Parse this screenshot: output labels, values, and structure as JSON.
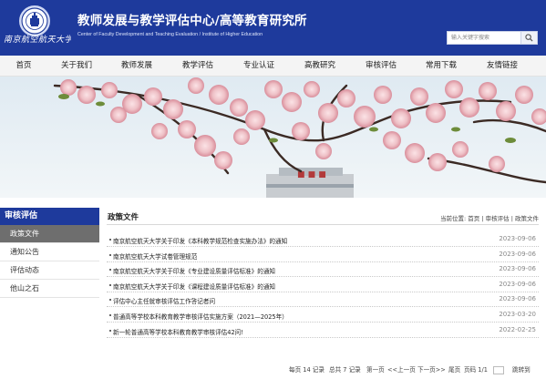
{
  "header": {
    "site_title": "教师发展与教学评估中心/高等教育研究所",
    "site_subtitle": "Center of Faculty Development and Teaching Evaluation / Institute of Higher Education",
    "logo_text": "南京航空航天大学",
    "search_placeholder": "输入关键字搜索",
    "brand_color": "#1e3a9c"
  },
  "nav": {
    "items": [
      "首页",
      "关于我们",
      "教师发展",
      "教学评估",
      "专业认证",
      "高教研究",
      "审核评估",
      "常用下载",
      "友情链接"
    ]
  },
  "sidebar": {
    "title": "审核评估",
    "items": [
      "政策文件",
      "通知公告",
      "评估动态",
      "他山之石"
    ],
    "active_index": 0
  },
  "main": {
    "title": "政策文件",
    "breadcrumb": {
      "prefix": "当前位置:",
      "home": "首页",
      "sep": "|",
      "section": "审核评估",
      "current": "政策文件"
    },
    "items": [
      {
        "title": "南京航空航天大学关于印发《本科教学规范检查实施办法》的通知",
        "date": "2023-09-06"
      },
      {
        "title": "南京航空航天大学试卷管理规范",
        "date": "2023-09-06"
      },
      {
        "title": "南京航空航天大学关于印发《专业建设质量评估标准》的通知",
        "date": "2023-09-06"
      },
      {
        "title": "南京航空航天大学关于印发《课程建设质量评估标准》的通知",
        "date": "2023-09-06"
      },
      {
        "title": "评估中心主任就审核评估工作答记者问",
        "date": "2023-09-06"
      },
      {
        "title": "普通高等学校本科教育教学审核评估实施方案（2021—2025年）",
        "date": "2023-03-20"
      },
      {
        "title": "新一轮普通高等学校本科教育教学审核评估42问!",
        "date": "2022-02-25"
      }
    ]
  },
  "pager": {
    "per_page": "每页 14 记录",
    "total": "总共 7 记录",
    "first": "第一页",
    "prev": "<<上一页",
    "next": "下一页>>",
    "last": "尾页",
    "page_info": "页码 1/1",
    "jump": "跳转到"
  }
}
